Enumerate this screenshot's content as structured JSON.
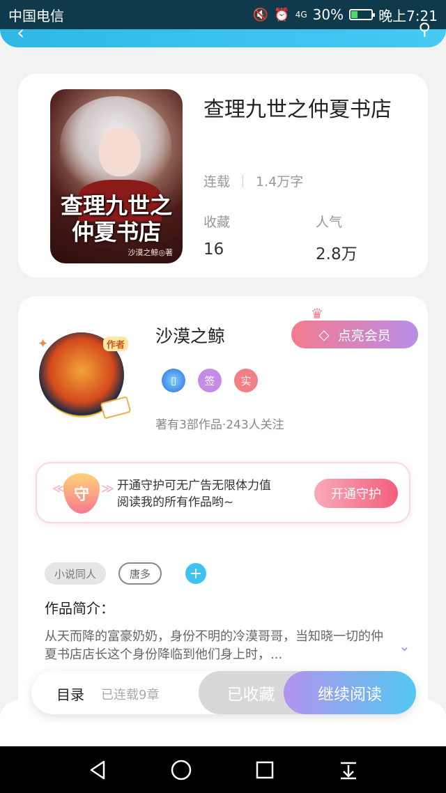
{
  "status_bar": {
    "carrier": "中国电信",
    "signal": "4G",
    "battery": "30%",
    "time": "晚上7:21"
  },
  "book": {
    "cover_title": "查理九世之仲夏书店",
    "cover_author": "沙漠之鲸◎著",
    "title": "查理九世之仲夏书店",
    "status": "连载",
    "word_count": "1.4万字",
    "fav_label": "收藏",
    "fav_value": "16",
    "pop_label": "人气",
    "pop_value": "2.8万"
  },
  "author": {
    "name": "沙漠之鲸",
    "avatar_badge": "作者",
    "vip_label": "点亮会员",
    "badges": [
      "签",
      "实"
    ],
    "stats": "著有3部作品·243人关注"
  },
  "guard": {
    "shield_text": "守",
    "line1": "开通守护可无广告无限体力值",
    "line2": "阅读我的所有作品哟~",
    "button": "开通守护"
  },
  "tags": [
    "小说同人",
    "唐多"
  ],
  "intro": {
    "label": "作品简介：",
    "text": "从天而降的富豪奶奶，身份不明的冷漠哥哥，当知晓一切的仲夏书店店长这个身份降临到他们身上时，..."
  },
  "action_bar": {
    "toc": "目录",
    "chapters": "已连载9章",
    "collected": "已收藏",
    "read": "继续阅读"
  }
}
